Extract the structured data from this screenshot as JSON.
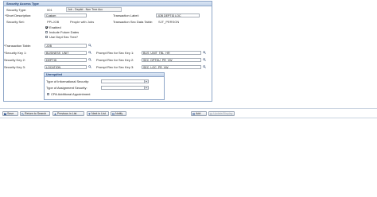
{
  "panel": {
    "title": "Security Access Type"
  },
  "security_type": {
    "label": "Security Type:",
    "code": "001",
    "description": "Job - Deptid - Non Tree Acc"
  },
  "short_description": {
    "label": "*Short Description:",
    "value": "Custom"
  },
  "transaction_label": {
    "label": "Transaction Label:",
    "value": "JOB DEPTID LOC"
  },
  "security_set": {
    "label": "Security Set:",
    "code": "PPLJOB",
    "description": "People with Jobs"
  },
  "trans_sec_data_table": {
    "label": "Transaction Sec Data Table:",
    "value": "SJT_PERSON"
  },
  "checkboxes": [
    {
      "label": "Enabled",
      "checked": true
    },
    {
      "label": "Include Future Dates",
      "checked": false
    },
    {
      "label": "Use Dept Sec Tree?",
      "checked": false
    }
  ],
  "transaction_table": {
    "label": "*Transaction Table:",
    "value": "JOB"
  },
  "keys": [
    {
      "label": "*Security Key 1:",
      "value": "BUSINESS_UNIT",
      "prompt_label": "Prompt Rec for Sec Key 1:",
      "prompt_value": "BUS_UNIT_TBL_HR"
    },
    {
      "label": "Security Key 2:",
      "value": "DEPTID",
      "prompt_label": "Prompt Rec for Sec Key 2:",
      "prompt_value": "SEC_DPTDU_PR_VW"
    },
    {
      "label": "Security Key 3:",
      "value": "LOCATION",
      "prompt_label": "Prompt Rec for Sec Key 3:",
      "prompt_value": "SEC_LOC_PR_VW"
    }
  ],
  "group": {
    "title": "Unrequited",
    "type_of_info_security": {
      "label": "Type of Informational Security:",
      "value": ""
    },
    "type_of_assignment_security": {
      "label": "Type of Assignment Security:",
      "value": ""
    },
    "cpa": {
      "label": "CPA Additional Appointment",
      "checked": false
    }
  },
  "toolbar": {
    "save": "Save",
    "return_to_search": "Return to Search",
    "previous_in_list": "Previous in List",
    "next_in_list": "Next in List",
    "notify": "Notify",
    "add": "Add",
    "update_display": "Update/Display"
  },
  "colors": {
    "accent": "#1b3b6f",
    "panel_border": "#8ea6c8",
    "lookup": "#5a6d8c"
  }
}
